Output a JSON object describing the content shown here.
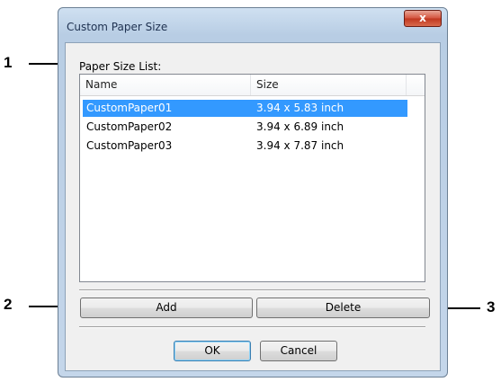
{
  "window": {
    "title": "Custom Paper Size",
    "close_glyph": "x"
  },
  "paper_size_list": {
    "label": "Paper Size List:",
    "columns": [
      "Name",
      "Size"
    ],
    "rows": [
      {
        "name": "CustomPaper01",
        "size": "3.94 x 5.83 inch",
        "selected": true
      },
      {
        "name": "CustomPaper02",
        "size": "3.94 x 6.89 inch",
        "selected": false
      },
      {
        "name": "CustomPaper03",
        "size": "3.94 x 7.87 inch",
        "selected": false
      }
    ]
  },
  "buttons": {
    "add": "Add",
    "delete": "Delete",
    "ok": "OK",
    "cancel": "Cancel"
  },
  "callouts": {
    "one": "1",
    "two": "2",
    "three": "3"
  },
  "colors": {
    "selection": "#3399ff",
    "close_button": "#c0361f"
  }
}
